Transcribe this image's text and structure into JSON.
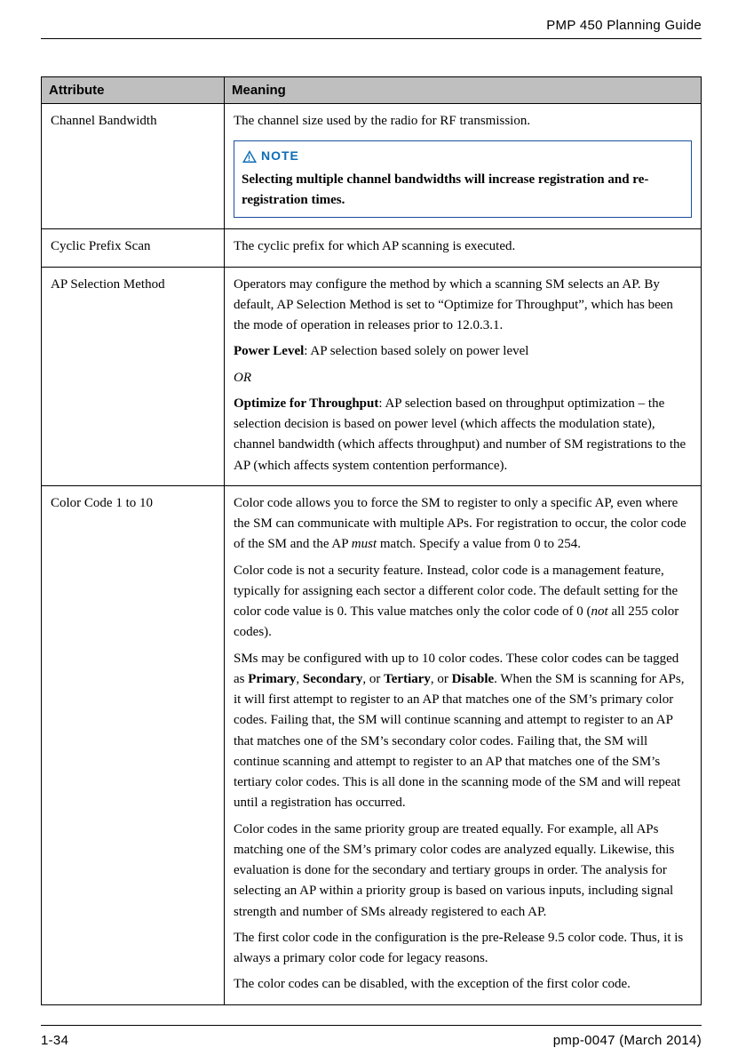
{
  "header": {
    "title": "PMP 450 Planning Guide"
  },
  "footer": {
    "left": "1-34",
    "right": "pmp-0047 (March 2014)"
  },
  "note": {
    "label": "NOTE"
  },
  "table": {
    "headers": {
      "attr": "Attribute",
      "meaning": "Meaning"
    },
    "rows": {
      "r1": {
        "attr": "Channel Bandwidth",
        "intro": "The channel size used by the radio for RF transmission.",
        "note_text": "Selecting multiple channel bandwidths will increase registration and re-registration times."
      },
      "r2": {
        "attr": "Cyclic Prefix Scan",
        "p1": "The cyclic prefix for which AP scanning is executed."
      },
      "r3": {
        "attr": "AP Selection Method",
        "p1": "Operators may configure the method by which a scanning SM selects an AP. By default, AP Selection Method is set to “Optimize for Throughput”, which has been the mode of operation in releases prior to 12.0.3.1.",
        "p2a": "Power Level",
        "p2b": ":  AP selection based solely on power level",
        "p3": "OR",
        "p4a": "Optimize for Throughput",
        "p4b": ":  AP selection based on throughput optimization – the selection decision is based on power level (which affects the modulation state), channel bandwidth (which affects throughput) and number of SM registrations to the AP (which affects system contention performance)."
      },
      "r4": {
        "attr": "Color Code 1 to 10",
        "p1a": "Color code allows you to force the SM to register to only a specific AP, even where the SM can communicate with multiple APs. For registration to occur, the color code of the SM and the AP ",
        "p1b": "must",
        "p1c": " match. Specify a value from 0 to 254.",
        "p2a": "Color code is not a security feature. Instead, color code is a management feature, typically for assigning each sector a different color code. The default setting for the color code value is 0. This value matches only the color code of 0 (",
        "p2b": "not",
        "p2c": " all 255 color codes).",
        "p3a": "SMs may be configured with up to 10 color codes.  These color codes can be tagged as ",
        "p3b": "Primary",
        "p3c": ", ",
        "p3d": "Secondary",
        "p3e": ", or ",
        "p3f": "Tertiary",
        "p3g": ", or ",
        "p3h": "Disable",
        "p3i": ".  When the SM is scanning for APs, it will first attempt to register to an AP that matches one of the SM’s primary color codes.  Failing that, the SM will continue scanning and attempt to register to an AP that matches one of the SM’s secondary color codes.  Failing that, the SM will continue scanning and attempt to register to an AP that matches one of the SM’s tertiary color codes.  This is all done in the scanning mode of the SM and will repeat until a registration has occurred.",
        "p4": "Color codes in the same priority group are treated equally.  For example, all APs matching one of the SM’s primary color codes are analyzed equally.  Likewise, this evaluation is done for the secondary and tertiary groups in order.  The analysis for selecting an AP within a priority group is based on various inputs, including signal strength and number of SMs already registered to each AP.",
        "p5": "The first color code in the configuration is the pre-Release 9.5 color code.  Thus, it is always a primary color code for legacy reasons.",
        "p6": "The color codes can be disabled, with the exception of the first color code."
      }
    }
  }
}
